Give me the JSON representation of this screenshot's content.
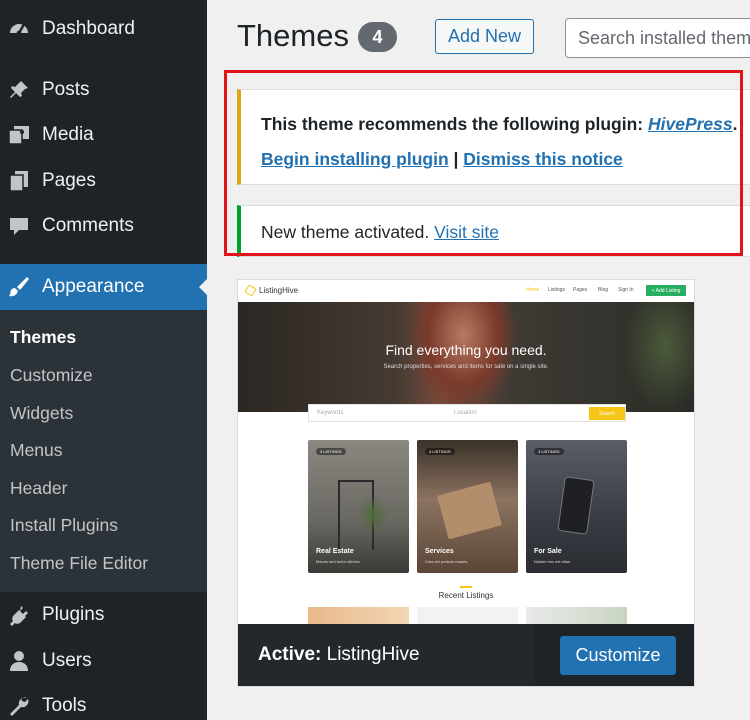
{
  "sidebar": {
    "items": [
      {
        "label": "Dashboard",
        "icon": "dashboard-icon"
      },
      {
        "label": "Posts",
        "icon": "pin-icon"
      },
      {
        "label": "Media",
        "icon": "media-icon"
      },
      {
        "label": "Pages",
        "icon": "pages-icon"
      },
      {
        "label": "Comments",
        "icon": "comment-icon"
      },
      {
        "label": "Appearance",
        "icon": "brush-icon",
        "active": true
      },
      {
        "label": "Plugins",
        "icon": "plug-icon"
      },
      {
        "label": "Users",
        "icon": "user-icon"
      },
      {
        "label": "Tools",
        "icon": "wrench-icon"
      }
    ],
    "submenu": [
      "Themes",
      "Customize",
      "Widgets",
      "Menus",
      "Header",
      "Install Plugins",
      "Theme File Editor"
    ]
  },
  "header": {
    "title": "Themes",
    "count": "4",
    "add_new": "Add New",
    "search_placeholder": "Search installed themes..."
  },
  "notices": {
    "plugin": {
      "text": "This theme recommends the following plugin:",
      "plugin_link": "HivePress",
      "period": ".",
      "begin_link": "Begin installing plugin",
      "separator": "|",
      "dismiss_link": "Dismiss this notice",
      "accent": "#dba617"
    },
    "activated": {
      "text": "New theme activated.",
      "visit_link": "Visit site",
      "accent": "#00a32a"
    }
  },
  "theme_card": {
    "active_label": "Active:",
    "theme_name": "ListingHive",
    "customize": "Customize",
    "screenshot": {
      "logo": "ListingHive",
      "nav": [
        "Home",
        "Listings",
        "Pages",
        "Blog",
        "Sign In"
      ],
      "add_listing": "+ Add Listing",
      "hero_title": "Find everything you need.",
      "hero_subtitle": "Search properties, services and items for sale on a single site.",
      "keywords_placeholder": "Keywords",
      "location_placeholder": "Location",
      "search_button": "Search",
      "categories": [
        {
          "tag": "3 LISTINGS",
          "title": "Real Estate",
          "subtitle": "Mauris sed tortor ultrices."
        },
        {
          "tag": "4 LISTINGS",
          "title": "Services",
          "subtitle": "Cras vel pretium mauris."
        },
        {
          "tag": "3 LISTINGS",
          "title": "For Sale",
          "subtitle": "Nullam nec est vitae."
        }
      ],
      "recent_title": "Recent Listings"
    }
  },
  "colors": {
    "sidebar_bg": "#1d2327",
    "accent_blue": "#2271b1",
    "highlight_red": "#e2141a"
  }
}
